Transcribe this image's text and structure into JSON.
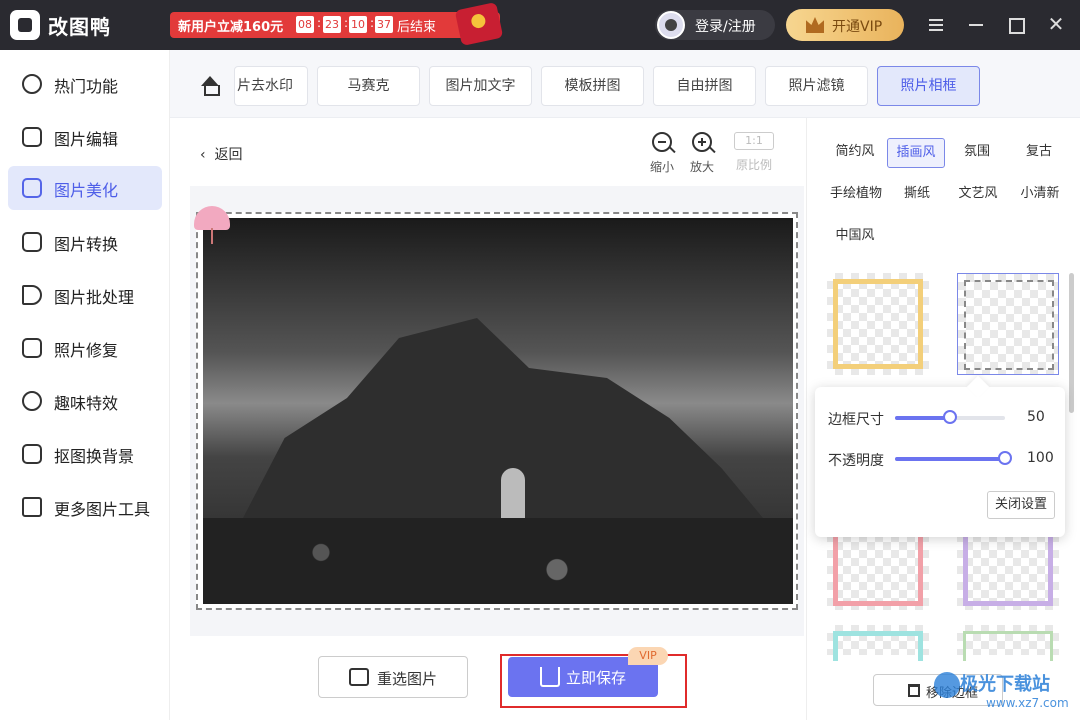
{
  "app": {
    "name": "改图鸭"
  },
  "promo": {
    "text": "新用户立减160元",
    "countdown": [
      "08",
      "23",
      "10",
      "37"
    ],
    "suffix": "后结束"
  },
  "header": {
    "login": "登录/注册",
    "vip": "开通VIP"
  },
  "sidebar": {
    "items": [
      {
        "label": "热门功能",
        "icon": "fire-icon"
      },
      {
        "label": "图片编辑",
        "icon": "image-edit-icon"
      },
      {
        "label": "图片美化",
        "icon": "image-beautify-icon",
        "active": true
      },
      {
        "label": "图片转换",
        "icon": "convert-icon"
      },
      {
        "label": "图片批处理",
        "icon": "batch-icon"
      },
      {
        "label": "照片修复",
        "icon": "repair-icon"
      },
      {
        "label": "趣味特效",
        "icon": "sparkle-icon"
      },
      {
        "label": "抠图换背景",
        "icon": "cutout-icon"
      },
      {
        "label": "更多图片工具",
        "icon": "toolbox-icon"
      }
    ]
  },
  "tabs": [
    "片去水印",
    "马赛克",
    "图片加文字",
    "模板拼图",
    "自由拼图",
    "照片滤镜",
    "照片相框"
  ],
  "activeTab": "照片相框",
  "editor": {
    "back": "返回",
    "zoom_out": "缩小",
    "zoom_in": "放大",
    "ratio_box": "1:1",
    "ratio": "原比例"
  },
  "actions": {
    "reselect": "重选图片",
    "save": "立即保存",
    "vip_tag": "VIP"
  },
  "styles": [
    "简约风",
    "插画风",
    "氛围",
    "复古",
    "手绘植物",
    "撕纸",
    "文艺风",
    "小清新",
    "中国风"
  ],
  "activeStyle": "插画风",
  "settings": {
    "size_label": "边框尺寸",
    "size_value": "50",
    "size_level": 0.5,
    "opacity_label": "不透明度",
    "opacity_value": "100",
    "opacity_level": 1.0,
    "close": "关闭设置"
  },
  "remove_border": "移除边框",
  "watermark": {
    "text": "极光下载站",
    "url": "www.xz7.com"
  },
  "colors": {
    "accent": "#6b73f0",
    "promo": "#e23a3a",
    "vip": "#e9b35c",
    "highlight": "#e02b2b"
  }
}
